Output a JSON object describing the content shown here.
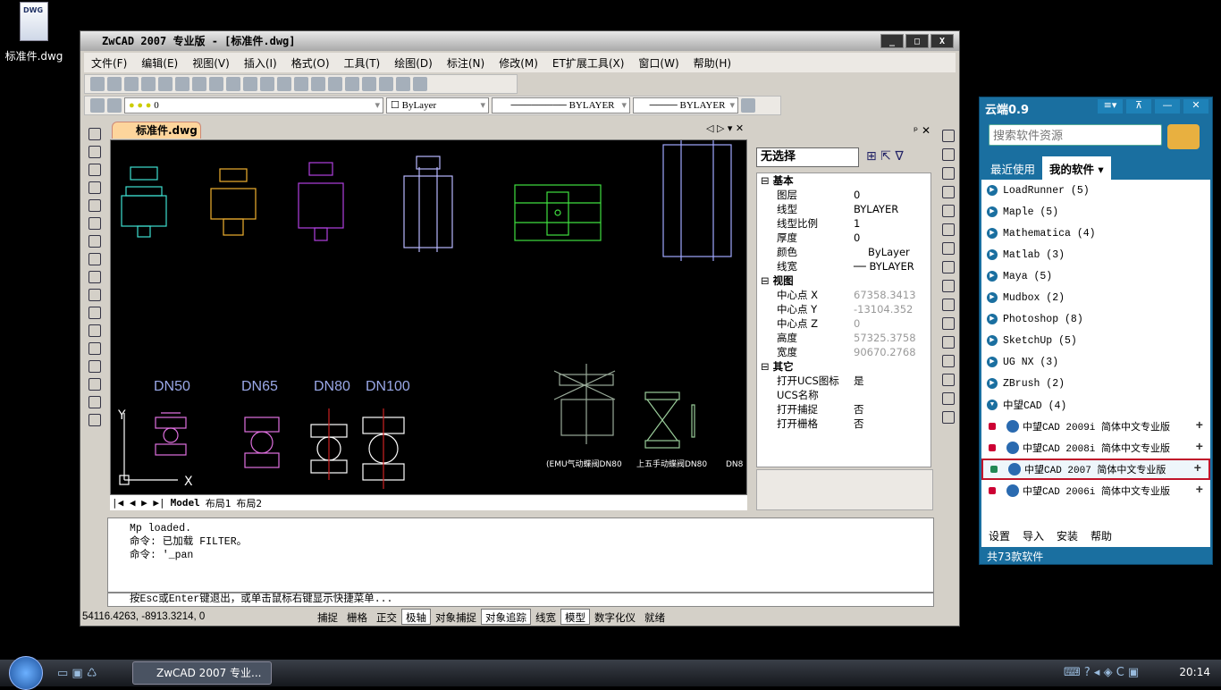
{
  "desktop": {
    "icon_label": "标准件.dwg",
    "icon_letters": "DWG"
  },
  "window": {
    "title": "ZwCAD 2007 专业版 - [标准件.dwg]",
    "controls": [
      "_",
      "□",
      "X"
    ]
  },
  "menu": [
    "文件(F)",
    "编辑(E)",
    "视图(V)",
    "插入(I)",
    "格式(O)",
    "工具(T)",
    "绘图(D)",
    "标注(N)",
    "修改(M)",
    "ET扩展工具(X)",
    "窗口(W)",
    "帮助(H)"
  ],
  "toolbar2": {
    "layer": "0",
    "color": "ByLayer",
    "linetype": "BYLAYER",
    "lineweight": "BYLAYER"
  },
  "doc_tab": "标准件.dwg",
  "drawing": {
    "labels": [
      "DN50",
      "DN65",
      "DN80",
      "DN100"
    ],
    "captions": [
      "(EMU气动蝶阀DN80",
      "上五手动蝶阀DN80",
      "DN8"
    ],
    "axis_x": "X",
    "axis_y": "Y"
  },
  "layout_tabs": [
    "Model",
    "布局1",
    "布局2"
  ],
  "properties": {
    "selection": "无选择",
    "categories": [
      {
        "name": "基本",
        "rows": [
          [
            "图层",
            "0"
          ],
          [
            "线型",
            "BYLAYER"
          ],
          [
            "线型比例",
            "1"
          ],
          [
            "厚度",
            "0"
          ],
          [
            "颜色",
            "ByLayer"
          ],
          [
            "线宽",
            "── BYLAYER"
          ]
        ]
      },
      {
        "name": "视图",
        "rows": [
          [
            "中心点 X",
            "67358.3413"
          ],
          [
            "中心点 Y",
            "-13104.352"
          ],
          [
            "中心点 Z",
            "0"
          ],
          [
            "高度",
            "57325.3758"
          ],
          [
            "宽度",
            "90670.2768"
          ]
        ]
      },
      {
        "name": "其它",
        "rows": [
          [
            "打开UCS图标",
            "是"
          ],
          [
            "UCS名称",
            ""
          ],
          [
            "打开捕捉",
            "否"
          ],
          [
            "打开栅格",
            "否"
          ]
        ]
      }
    ]
  },
  "command": {
    "history": [
      "Mp loaded.",
      "命令:   已加载 FILTER。",
      "命令: '_pan"
    ],
    "prompt": "按Esc或Enter键退出，或单击鼠标右键显示快捷菜单...",
    "close": "X"
  },
  "status": {
    "coords": "54116.4263, -8913.3214, 0",
    "toggles": [
      {
        "label": "捕捉",
        "on": false
      },
      {
        "label": "栅格",
        "on": false
      },
      {
        "label": "正交",
        "on": false
      },
      {
        "label": "极轴",
        "on": true
      },
      {
        "label": "对象捕捉",
        "on": false
      },
      {
        "label": "对象追踪",
        "on": true
      },
      {
        "label": "线宽",
        "on": false
      },
      {
        "label": "模型",
        "on": true
      },
      {
        "label": "数字化仪",
        "on": false
      },
      {
        "label": "就绪",
        "on": false
      }
    ]
  },
  "yunduan": {
    "title": "云端0.9",
    "search_placeholder": "搜索软件资源",
    "tabs": [
      "最近使用",
      "我的软件 ▾"
    ],
    "groups": [
      "LoadRunner  (5)",
      "Maple  (5)",
      "Mathematica  (4)",
      "Matlab  (3)",
      "Maya  (5)",
      "Mudbox  (2)",
      "Photoshop  (8)",
      "SketchUp  (5)",
      "UG NX  (3)",
      "ZBrush  (2)",
      "中望CAD  (4)"
    ],
    "subitems": [
      "中望CAD 2009i 简体中文专业版",
      "中望CAD 2008i 简体中文专业版",
      "中望CAD 2007  简体中文专业版",
      "中望CAD 2006i 简体中文专业版"
    ],
    "selected_index": 2,
    "footer": [
      "设置",
      "导入",
      "安装",
      "帮助"
    ],
    "count": "共73款软件"
  },
  "taskbar": {
    "task": "ZwCAD 2007 专业...",
    "clock": "20:14"
  }
}
